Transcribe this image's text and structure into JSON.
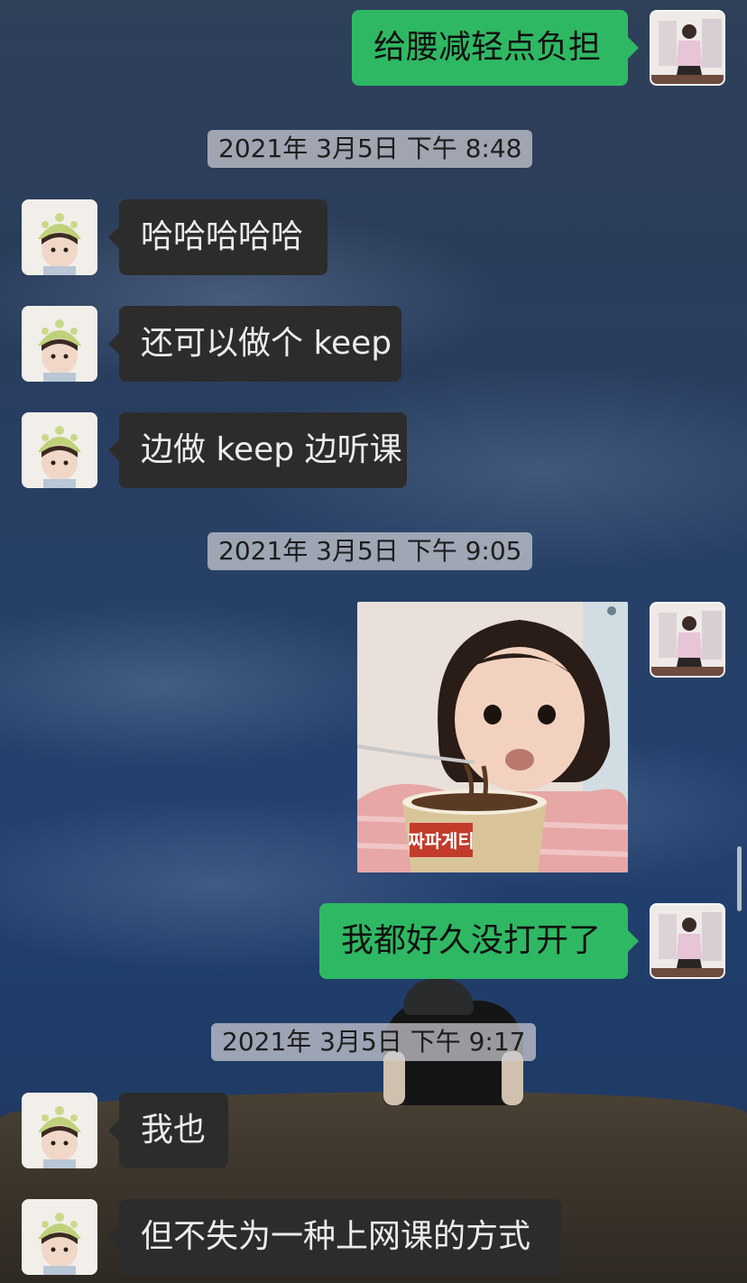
{
  "conversation": {
    "messages": [
      {
        "side": "right",
        "text": "给腰减轻点负担"
      },
      {
        "timestamp": "2021年 3月5日 下午 8:48"
      },
      {
        "side": "left",
        "text": "哈哈哈哈哈"
      },
      {
        "side": "left",
        "text": "还可以做个 keep"
      },
      {
        "side": "left",
        "text": "边做 keep 边听课"
      },
      {
        "timestamp": "2021年 3月5日 下午 9:05"
      },
      {
        "side": "right",
        "type": "sticker",
        "sticker_text": "짜파게티"
      },
      {
        "side": "right",
        "text": "我都好久没打开了"
      },
      {
        "timestamp": "2021年 3月5日 下午 9:17"
      },
      {
        "side": "left",
        "text": "我也"
      },
      {
        "side": "left",
        "text": "但不失为一种上网课的方式"
      }
    ]
  },
  "colors": {
    "sent_bubble": "#2fb863",
    "received_bubble": "#2c2c2c",
    "timestamp_bg": "#cdcdd2"
  }
}
